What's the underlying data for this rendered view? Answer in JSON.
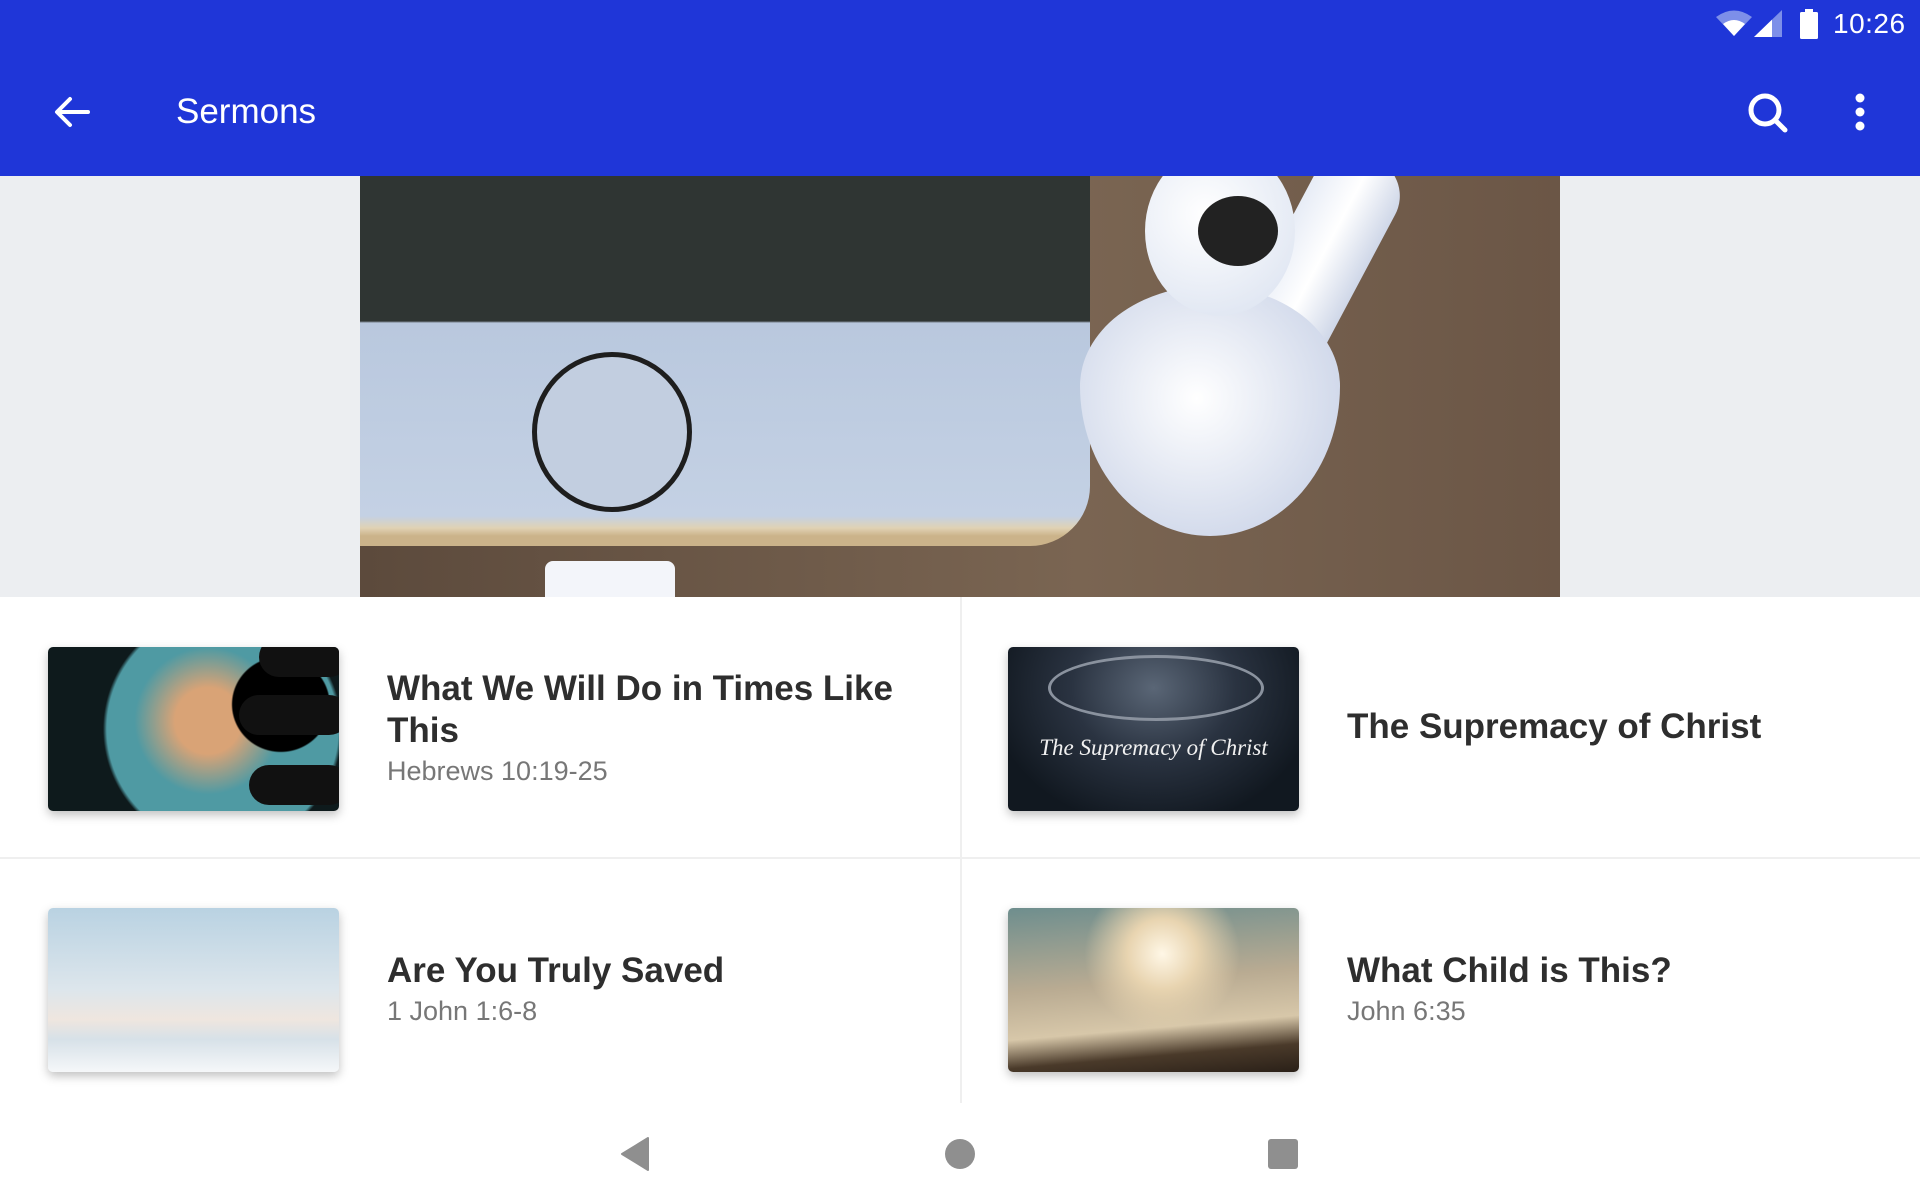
{
  "status_bar": {
    "time": "10:26",
    "icons": [
      "wifi-icon",
      "cell-signal-icon",
      "battery-icon"
    ]
  },
  "app_bar": {
    "title": "Sermons",
    "back_icon": "arrow-left-icon",
    "actions": [
      "search-icon",
      "more-vert-icon"
    ],
    "color": "#1f36d8"
  },
  "hero": {
    "image": "phone-and-earbuds-photo"
  },
  "sermons": [
    {
      "title": "What We Will Do in Times Like This",
      "scripture": "Hebrews 10:19-25",
      "thumbnail": "globe-hand-photo"
    },
    {
      "title": "The Supremacy of Christ",
      "scripture": "",
      "thumbnail": "crown-of-thorns-photo",
      "thumbnail_caption": "The Supremacy of Christ"
    },
    {
      "title": "Are You Truly Saved",
      "scripture": "1 John 1:6-8",
      "thumbnail": "clouds-sky-photo"
    },
    {
      "title": "What Child is This?",
      "scripture": "John 6:35",
      "thumbnail": "sunlit-clouds-photo"
    }
  ],
  "nav_bar": {
    "buttons": [
      "back-triangle-icon",
      "home-circle-icon",
      "recents-square-icon"
    ]
  }
}
